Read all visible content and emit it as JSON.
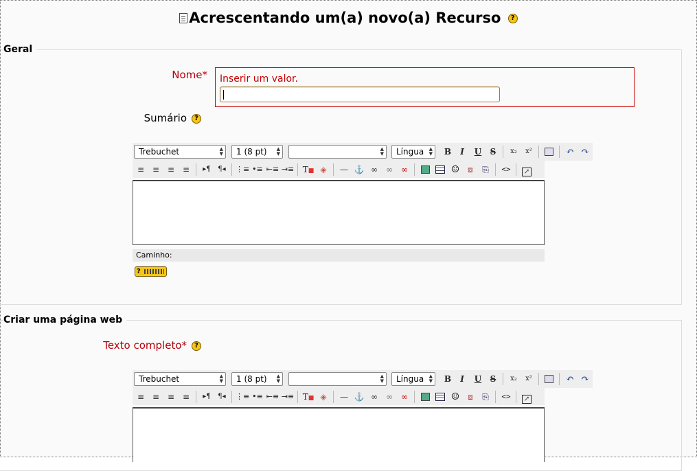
{
  "page": {
    "title": "Acrescentando um(a) novo(a) Recurso"
  },
  "sections": {
    "geral": {
      "legend": "Geral",
      "nome_label": "Nome",
      "nome_error": "Inserir um valor.",
      "nome_value": "",
      "sumario_label": "Sumário"
    },
    "web": {
      "legend": "Criar uma página web",
      "texto_label": "Texto completo"
    }
  },
  "required_mark": "*",
  "editor": {
    "font_family": "Trebuchet",
    "font_size": "1 (8 pt)",
    "heading": "",
    "language": "Língua",
    "path_label": "Caminho:"
  },
  "icons": {
    "bold": "B",
    "italic": "I",
    "underline": "U",
    "strike": "S",
    "subscript": "x₂",
    "superscript": "x²",
    "undo": "↶",
    "redo": "↷",
    "help": "?"
  },
  "colors": {
    "required": "#b5000c",
    "error": "#c80000",
    "help_yellow": "#f5c518"
  }
}
